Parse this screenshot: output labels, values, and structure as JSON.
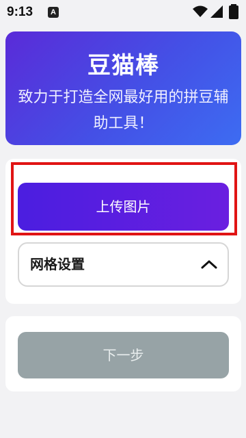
{
  "status_bar": {
    "time": "9:13",
    "notification_badge": "A",
    "icons": [
      "wifi-icon",
      "signal-icon",
      "battery-icon"
    ]
  },
  "header": {
    "title": "豆猫棒",
    "subtitle": "致力于打造全网最好用的拼豆辅助工具！"
  },
  "upload": {
    "button_label": "上传图片",
    "highlighted": true
  },
  "grid_settings": {
    "label": "网格设置",
    "expanded": true
  },
  "next_step": {
    "button_label": "下一步",
    "enabled": false
  },
  "colors": {
    "header_gradient_start": "#5a2bd8",
    "header_gradient_end": "#3d6cf2",
    "upload_button": "#5520e0",
    "highlight_border": "#e01414",
    "next_button_disabled": "#97a3a6",
    "background": "#f2f2f4"
  }
}
